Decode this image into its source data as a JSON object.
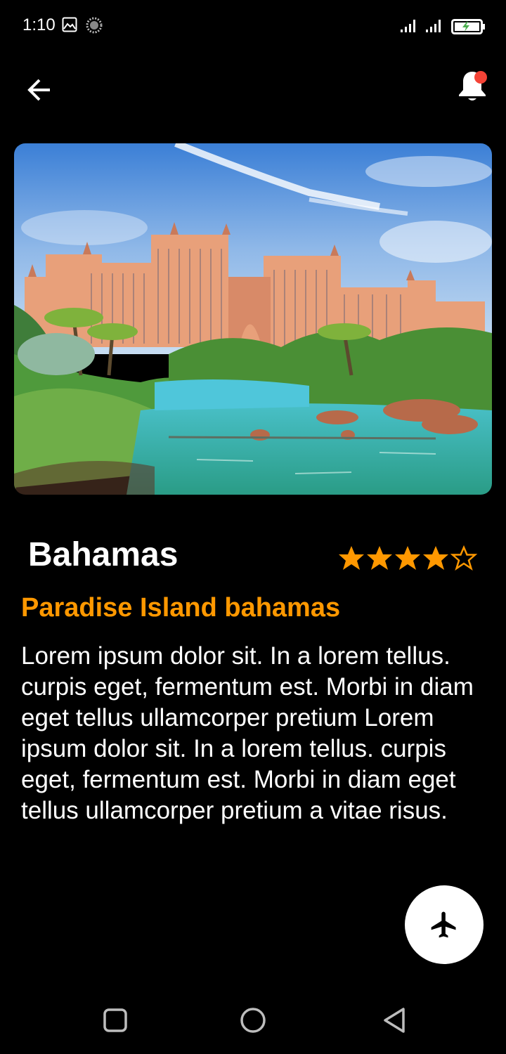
{
  "status_bar": {
    "time": "1:10",
    "icons": [
      "image-icon",
      "sync-icon",
      "signal-icon",
      "signal-icon",
      "battery-charging-icon"
    ]
  },
  "app_bar": {
    "back_icon": "arrow-left-icon",
    "notification_icon": "bell-icon",
    "notification_badge_color": "#f44336"
  },
  "hero": {
    "image": "resort-photo"
  },
  "place": {
    "title": "Bahamas",
    "subtitle": "Paradise Island bahamas",
    "rating": 4,
    "rating_max": 5,
    "description": "Lorem ipsum dolor sit. In a lorem tellus. curpis eget, fermentum est. Morbi in diam eget tellus ullamcorper pretium Lorem ipsum dolor sit. In a lorem tellus. curpis eget, fermentum est. Morbi in diam eget tellus ullamcorper pretium a vitae risus."
  },
  "fab": {
    "icon": "airplane-icon"
  },
  "nav_bar": {
    "icons": [
      "recents-square-icon",
      "home-circle-icon",
      "back-triangle-icon"
    ]
  },
  "colors": {
    "background": "#000000",
    "accent": "#ff9800",
    "text": "#ffffff",
    "fab_background": "#ffffff"
  }
}
